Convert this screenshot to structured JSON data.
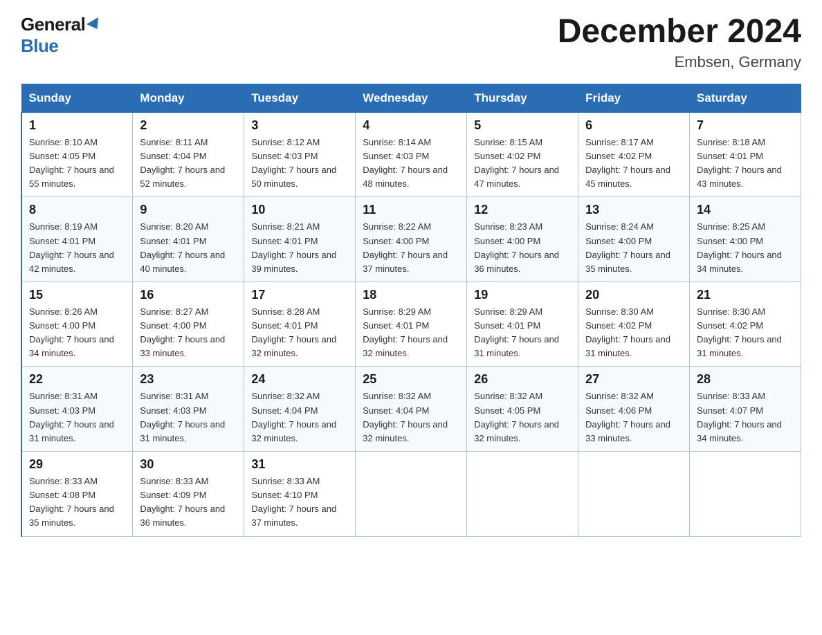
{
  "logo": {
    "general": "General",
    "blue": "Blue"
  },
  "title": "December 2024",
  "subtitle": "Embsen, Germany",
  "days_header": [
    "Sunday",
    "Monday",
    "Tuesday",
    "Wednesday",
    "Thursday",
    "Friday",
    "Saturday"
  ],
  "weeks": [
    [
      {
        "day": "1",
        "sunrise": "8:10 AM",
        "sunset": "4:05 PM",
        "daylight": "7 hours and 55 minutes."
      },
      {
        "day": "2",
        "sunrise": "8:11 AM",
        "sunset": "4:04 PM",
        "daylight": "7 hours and 52 minutes."
      },
      {
        "day": "3",
        "sunrise": "8:12 AM",
        "sunset": "4:03 PM",
        "daylight": "7 hours and 50 minutes."
      },
      {
        "day": "4",
        "sunrise": "8:14 AM",
        "sunset": "4:03 PM",
        "daylight": "7 hours and 48 minutes."
      },
      {
        "day": "5",
        "sunrise": "8:15 AM",
        "sunset": "4:02 PM",
        "daylight": "7 hours and 47 minutes."
      },
      {
        "day": "6",
        "sunrise": "8:17 AM",
        "sunset": "4:02 PM",
        "daylight": "7 hours and 45 minutes."
      },
      {
        "day": "7",
        "sunrise": "8:18 AM",
        "sunset": "4:01 PM",
        "daylight": "7 hours and 43 minutes."
      }
    ],
    [
      {
        "day": "8",
        "sunrise": "8:19 AM",
        "sunset": "4:01 PM",
        "daylight": "7 hours and 42 minutes."
      },
      {
        "day": "9",
        "sunrise": "8:20 AM",
        "sunset": "4:01 PM",
        "daylight": "7 hours and 40 minutes."
      },
      {
        "day": "10",
        "sunrise": "8:21 AM",
        "sunset": "4:01 PM",
        "daylight": "7 hours and 39 minutes."
      },
      {
        "day": "11",
        "sunrise": "8:22 AM",
        "sunset": "4:00 PM",
        "daylight": "7 hours and 37 minutes."
      },
      {
        "day": "12",
        "sunrise": "8:23 AM",
        "sunset": "4:00 PM",
        "daylight": "7 hours and 36 minutes."
      },
      {
        "day": "13",
        "sunrise": "8:24 AM",
        "sunset": "4:00 PM",
        "daylight": "7 hours and 35 minutes."
      },
      {
        "day": "14",
        "sunrise": "8:25 AM",
        "sunset": "4:00 PM",
        "daylight": "7 hours and 34 minutes."
      }
    ],
    [
      {
        "day": "15",
        "sunrise": "8:26 AM",
        "sunset": "4:00 PM",
        "daylight": "7 hours and 34 minutes."
      },
      {
        "day": "16",
        "sunrise": "8:27 AM",
        "sunset": "4:00 PM",
        "daylight": "7 hours and 33 minutes."
      },
      {
        "day": "17",
        "sunrise": "8:28 AM",
        "sunset": "4:01 PM",
        "daylight": "7 hours and 32 minutes."
      },
      {
        "day": "18",
        "sunrise": "8:29 AM",
        "sunset": "4:01 PM",
        "daylight": "7 hours and 32 minutes."
      },
      {
        "day": "19",
        "sunrise": "8:29 AM",
        "sunset": "4:01 PM",
        "daylight": "7 hours and 31 minutes."
      },
      {
        "day": "20",
        "sunrise": "8:30 AM",
        "sunset": "4:02 PM",
        "daylight": "7 hours and 31 minutes."
      },
      {
        "day": "21",
        "sunrise": "8:30 AM",
        "sunset": "4:02 PM",
        "daylight": "7 hours and 31 minutes."
      }
    ],
    [
      {
        "day": "22",
        "sunrise": "8:31 AM",
        "sunset": "4:03 PM",
        "daylight": "7 hours and 31 minutes."
      },
      {
        "day": "23",
        "sunrise": "8:31 AM",
        "sunset": "4:03 PM",
        "daylight": "7 hours and 31 minutes."
      },
      {
        "day": "24",
        "sunrise": "8:32 AM",
        "sunset": "4:04 PM",
        "daylight": "7 hours and 32 minutes."
      },
      {
        "day": "25",
        "sunrise": "8:32 AM",
        "sunset": "4:04 PM",
        "daylight": "7 hours and 32 minutes."
      },
      {
        "day": "26",
        "sunrise": "8:32 AM",
        "sunset": "4:05 PM",
        "daylight": "7 hours and 32 minutes."
      },
      {
        "day": "27",
        "sunrise": "8:32 AM",
        "sunset": "4:06 PM",
        "daylight": "7 hours and 33 minutes."
      },
      {
        "day": "28",
        "sunrise": "8:33 AM",
        "sunset": "4:07 PM",
        "daylight": "7 hours and 34 minutes."
      }
    ],
    [
      {
        "day": "29",
        "sunrise": "8:33 AM",
        "sunset": "4:08 PM",
        "daylight": "7 hours and 35 minutes."
      },
      {
        "day": "30",
        "sunrise": "8:33 AM",
        "sunset": "4:09 PM",
        "daylight": "7 hours and 36 minutes."
      },
      {
        "day": "31",
        "sunrise": "8:33 AM",
        "sunset": "4:10 PM",
        "daylight": "7 hours and 37 minutes."
      },
      null,
      null,
      null,
      null
    ]
  ]
}
